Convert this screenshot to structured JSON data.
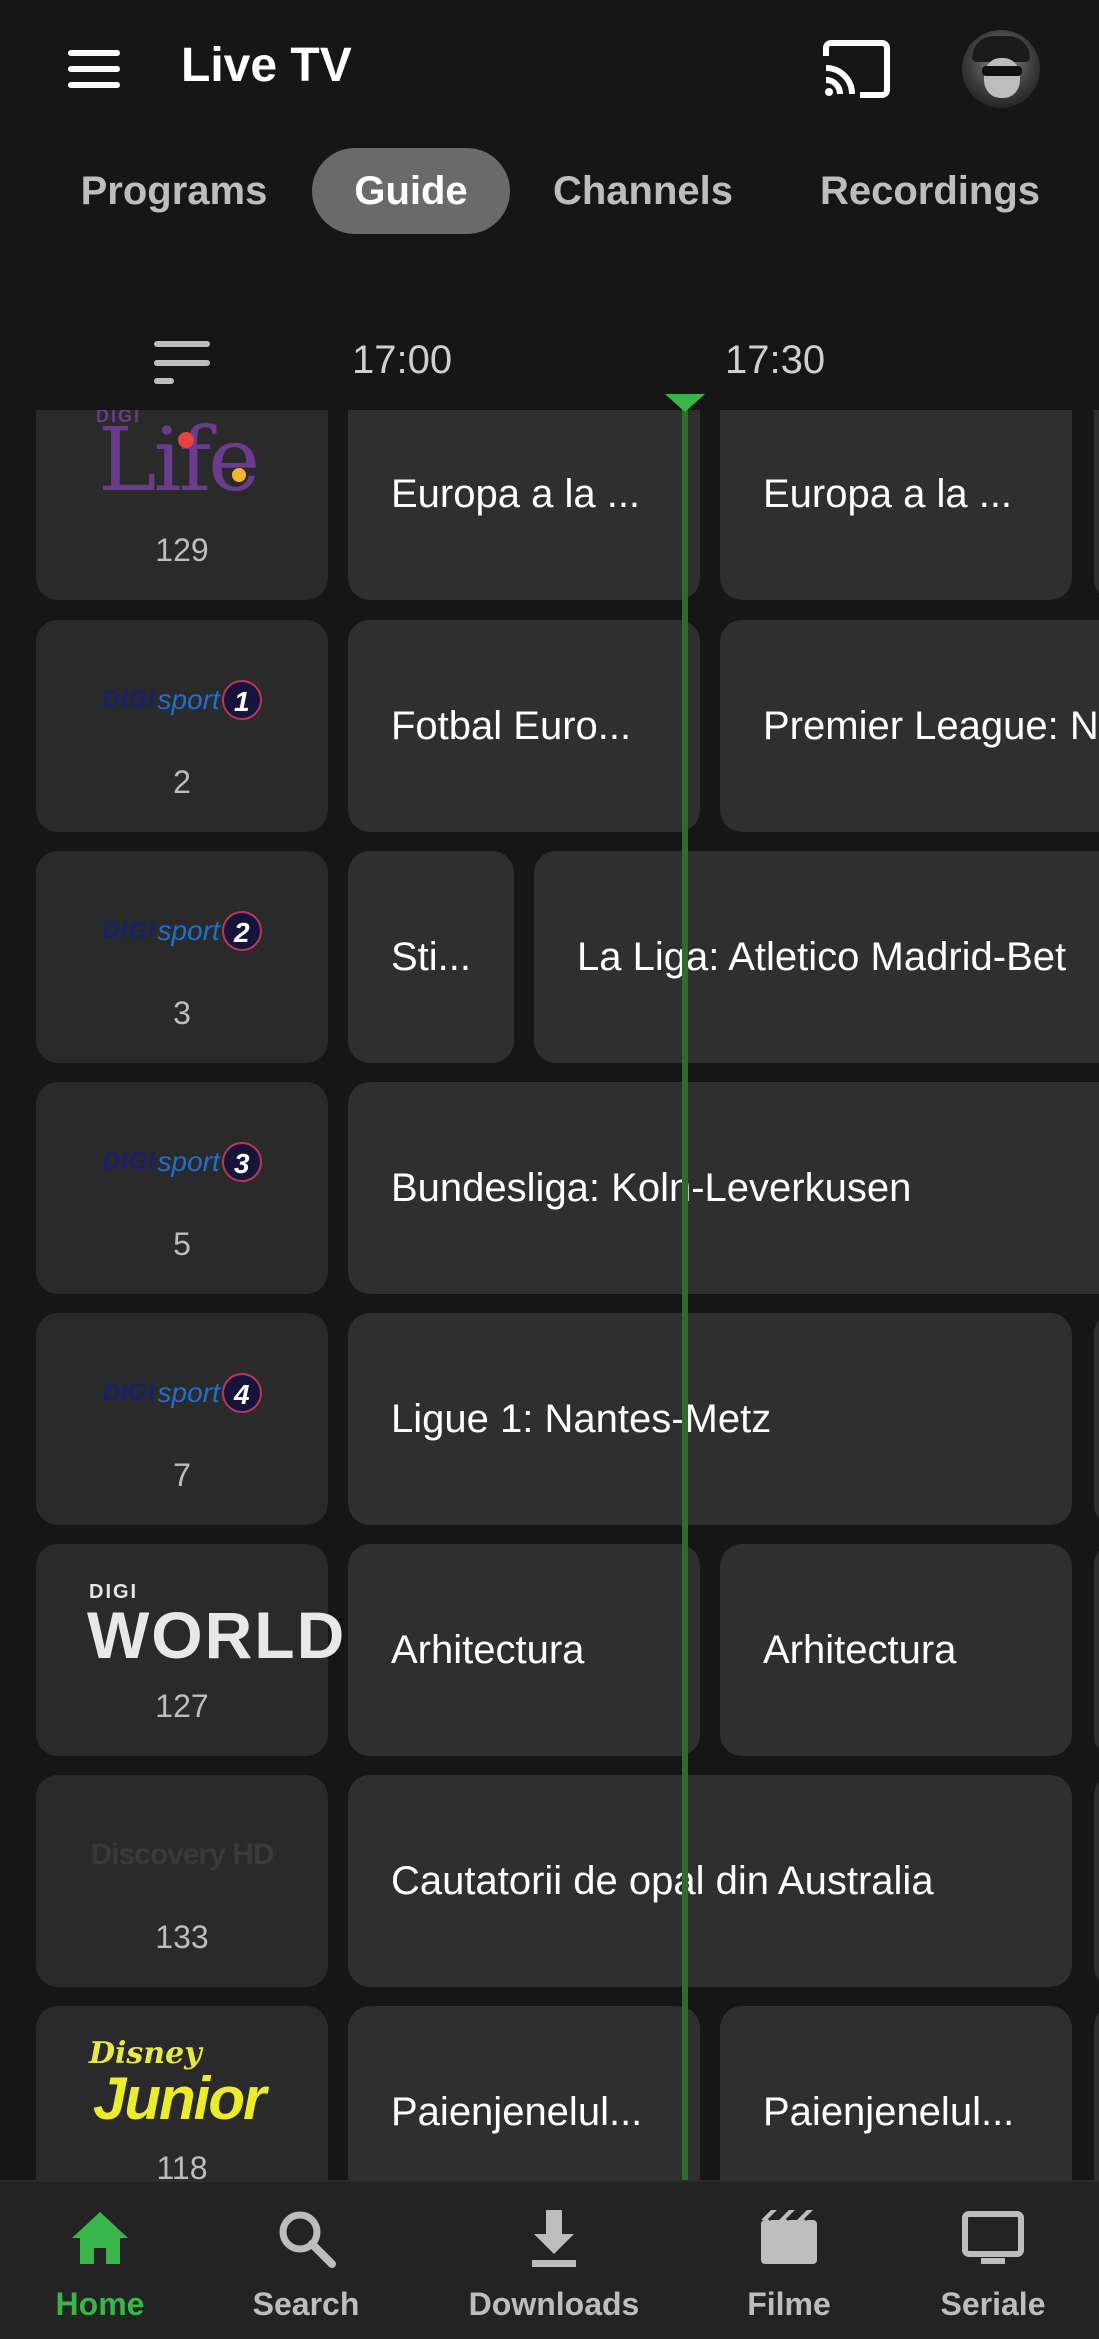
{
  "header": {
    "title": "Live TV"
  },
  "tabs": [
    {
      "label": "Programs"
    },
    {
      "label": "Guide",
      "active": true
    },
    {
      "label": "Channels"
    },
    {
      "label": "Recordings"
    }
  ],
  "timeline": {
    "times": [
      "17:00",
      "17:30"
    ]
  },
  "colors": {
    "accent": "#39b54a",
    "background": "#161616",
    "card": "#2a2a2a",
    "now_line": "#2e6c2e"
  },
  "guide": [
    {
      "channel": {
        "logo": "digi-life-logo",
        "number": "129",
        "logo_text": "Life",
        "logo_brand": "DIGI"
      },
      "programs": [
        {
          "title": "Europa a la ..."
        },
        {
          "title": "Europa a la ..."
        }
      ]
    },
    {
      "channel": {
        "logo": "digi-sport-1-logo",
        "number": "2",
        "logo_brand": "DIGI",
        "logo_text": "sport",
        "logo_num": "1"
      },
      "programs": [
        {
          "title": "Fotbal Euro..."
        },
        {
          "title": "Premier League: N"
        }
      ]
    },
    {
      "channel": {
        "logo": "digi-sport-2-logo",
        "number": "3",
        "logo_brand": "DIGI",
        "logo_text": "sport",
        "logo_num": "2"
      },
      "programs": [
        {
          "title": "Sti..."
        },
        {
          "title": "La Liga: Atletico Madrid-Bet"
        }
      ]
    },
    {
      "channel": {
        "logo": "digi-sport-3-logo",
        "number": "5",
        "logo_brand": "DIGI",
        "logo_text": "sport",
        "logo_num": "3"
      },
      "programs": [
        {
          "title": "Bundesliga: Koln-Leverkusen"
        }
      ]
    },
    {
      "channel": {
        "logo": "digi-sport-4-logo",
        "number": "7",
        "logo_brand": "DIGI",
        "logo_text": "sport",
        "logo_num": "4"
      },
      "programs": [
        {
          "title": "Ligue 1: Nantes-Metz"
        }
      ]
    },
    {
      "channel": {
        "logo": "digi-world-logo",
        "number": "127",
        "logo_brand": "DIGI",
        "logo_text": "WORLD"
      },
      "programs": [
        {
          "title": "Arhitectura"
        },
        {
          "title": "Arhitectura"
        }
      ]
    },
    {
      "channel": {
        "logo": "discovery-hd-logo",
        "number": "133",
        "logo_text": "Discovery HD"
      },
      "programs": [
        {
          "title": "Cautatorii de opal din Australia"
        }
      ]
    },
    {
      "channel": {
        "logo": "disney-junior-logo",
        "number": "118",
        "logo_brand": "Disney",
        "logo_text": "Junior"
      },
      "programs": [
        {
          "title": "Paienjenelul..."
        },
        {
          "title": "Paienjenelul..."
        }
      ]
    }
  ],
  "bottom_nav": [
    {
      "label": "Home",
      "icon": "home-icon",
      "active": true
    },
    {
      "label": "Search",
      "icon": "search-icon"
    },
    {
      "label": "Downloads",
      "icon": "download-icon"
    },
    {
      "label": "Filme",
      "icon": "movie-icon"
    },
    {
      "label": "Seriale",
      "icon": "tv-icon"
    }
  ]
}
